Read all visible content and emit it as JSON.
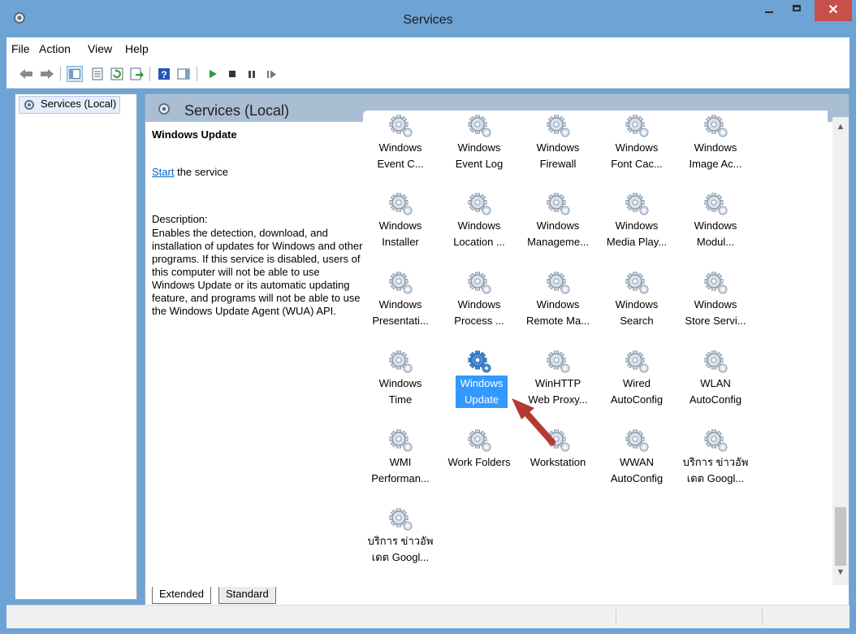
{
  "window": {
    "title": "Services"
  },
  "menu": [
    "File",
    "Action",
    "View",
    "Help"
  ],
  "toolbar": {
    "icons": [
      "back-icon",
      "forward-icon",
      "show-hide-console-tree-icon",
      "properties-icon",
      "refresh-icon",
      "export-list-icon",
      "help-icon",
      "show-action-pane-icon",
      "start-service-icon",
      "stop-service-icon",
      "pause-service-icon",
      "resume-service-icon"
    ]
  },
  "tree": {
    "root": "Services (Local)"
  },
  "pane": {
    "header": "Services (Local)",
    "selected_service": "Windows Update",
    "start_link": "Start",
    "start_suffix": " the service",
    "description_label": "Description:",
    "description": "Enables the detection, download, and installation of updates for Windows and other programs. If this service is disabled, users of this computer will not be able to use Windows Update or its automatic updating feature, and programs will not be able to use the Windows Update Agent (WUA) API."
  },
  "services": [
    {
      "label": "Windows\nEvent C..."
    },
    {
      "label": "Windows\nEvent Log"
    },
    {
      "label": "Windows\nFirewall"
    },
    {
      "label": "Windows\nFont Cac..."
    },
    {
      "label": "Windows\nImage Ac..."
    },
    {
      "label": "Windows\nInstaller"
    },
    {
      "label": "Windows\nLocation ..."
    },
    {
      "label": "Windows\nManageme..."
    },
    {
      "label": "Windows\nMedia Play..."
    },
    {
      "label": "Windows\nModul..."
    },
    {
      "label": "Windows\nPresentati..."
    },
    {
      "label": "Windows\nProcess ..."
    },
    {
      "label": "Windows\nRemote Ma..."
    },
    {
      "label": "Windows\nSearch"
    },
    {
      "label": "Windows\nStore Servi..."
    },
    {
      "label": "Windows\nTime"
    },
    {
      "label": "Windows\nUpdate",
      "selected": true
    },
    {
      "label": "WinHTTP\nWeb Proxy..."
    },
    {
      "label": "Wired\nAutoConfig"
    },
    {
      "label": "WLAN\nAutoConfig"
    },
    {
      "label": "WMI\nPerforman..."
    },
    {
      "label": "Work Folders"
    },
    {
      "label": "Workstation"
    },
    {
      "label": "WWAN\nAutoConfig"
    },
    {
      "label": "บริการ ข่าวอัพ\nเดต Googl..."
    },
    {
      "label": "บริการ ข่าวอัพ\nเดต Googl..."
    }
  ],
  "tabs": [
    "Extended",
    "Standard"
  ],
  "colors": {
    "selection": "#3399ff",
    "header": "#a9bed3",
    "titlebar": "#6ea3d6",
    "close": "#c7504a",
    "arrow": "#b23a33"
  }
}
